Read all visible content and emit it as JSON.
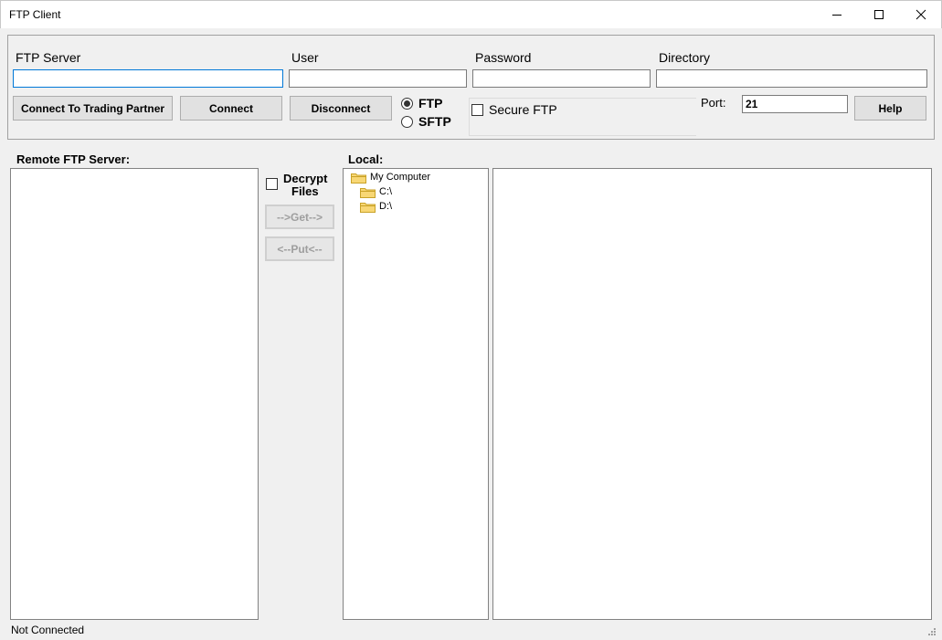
{
  "window": {
    "title": "FTP Client"
  },
  "connection": {
    "server_label": "FTP Server",
    "server_value": "",
    "user_label": "User",
    "user_value": "",
    "password_label": "Password",
    "password_value": "",
    "directory_label": "Directory",
    "directory_value": "",
    "connect_partner_label": "Connect To Trading Partner",
    "connect_label": "Connect",
    "disconnect_label": "Disconnect",
    "protocol_ftp_label": "FTP",
    "protocol_sftp_label": "SFTP",
    "protocol_selected": "FTP",
    "secure_ftp_label": "Secure FTP",
    "secure_ftp_checked": false,
    "port_label": "Port:",
    "port_value": "21",
    "help_label": "Help"
  },
  "remote": {
    "label": "Remote FTP Server:"
  },
  "transfer": {
    "decrypt_label_line1": "Decrypt",
    "decrypt_label_line2": "Files",
    "decrypt_checked": false,
    "get_label": "-->Get-->",
    "put_label": "<--Put<--"
  },
  "local": {
    "label": "Local:",
    "tree": {
      "root": "My Computer",
      "drives": [
        "C:\\",
        "D:\\"
      ]
    }
  },
  "status": {
    "text": "Not Connected"
  },
  "colors": {
    "focus_border": "#0078d7",
    "folder_fill": "#f8d775",
    "folder_stroke": "#c9a227"
  }
}
